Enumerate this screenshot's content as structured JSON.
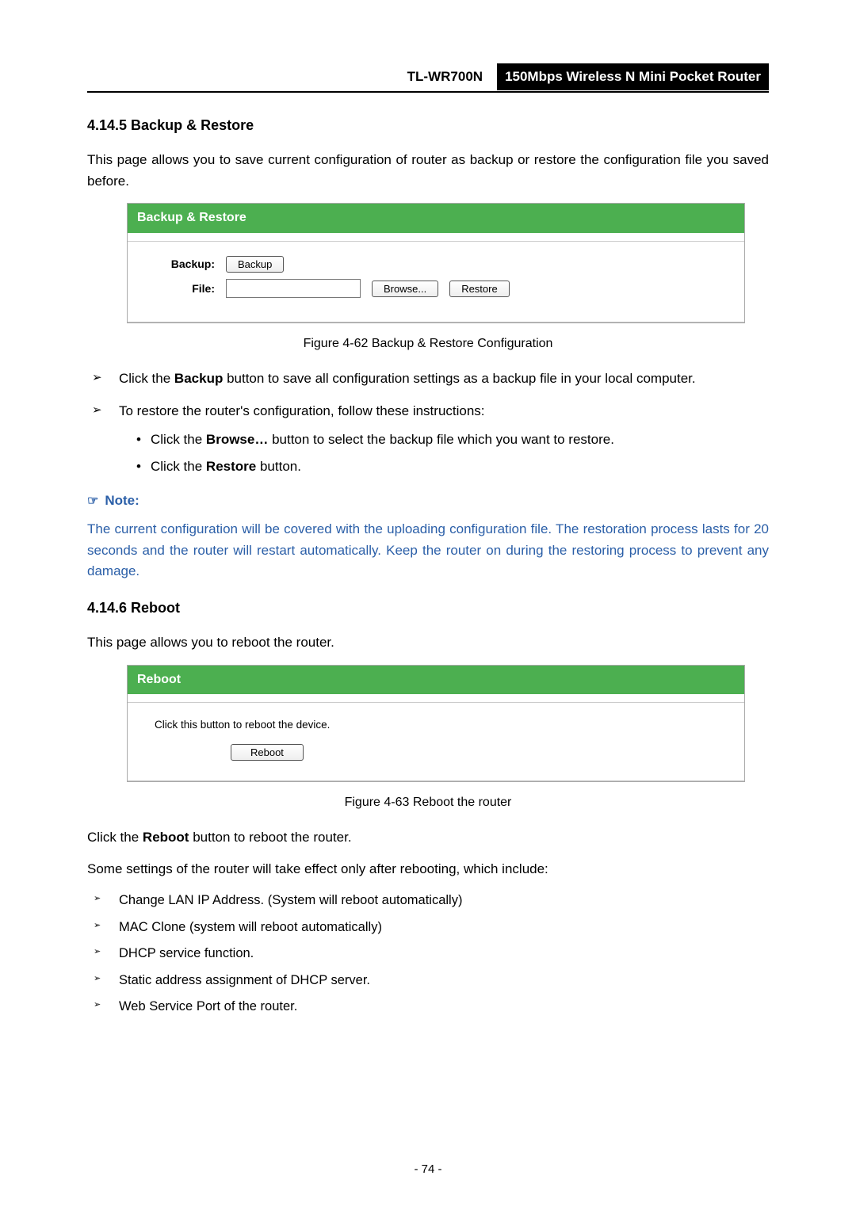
{
  "header": {
    "model": "TL-WR700N",
    "desc": "150Mbps Wireless N Mini Pocket Router"
  },
  "s1": {
    "heading": "4.14.5 Backup & Restore",
    "intro": "This page allows you to save current configuration of router as backup or restore the configuration file you saved before.",
    "panel_title": "Backup & Restore",
    "backup_label": "Backup:",
    "file_label": "File:",
    "backup_btn": "Backup",
    "browse_btn": "Browse...",
    "restore_btn": "Restore",
    "fig": "Figure 4-62 Backup & Restore Configuration",
    "li1a": "Click the ",
    "li1b": "Backup",
    "li1c": " button to save all configuration settings as a backup file in your local computer.",
    "li2": "To restore the router's configuration, follow these instructions:",
    "li2_1a": "Click the ",
    "li2_1b": "Browse…",
    "li2_1c": " button to select the backup file which you want to restore.",
    "li2_2a": "Click the ",
    "li2_2b": "Restore",
    "li2_2c": " button."
  },
  "note": {
    "label": "Note:",
    "body": "The current configuration will be covered with the uploading configuration file. The restoration process lasts for 20 seconds and the router will restart automatically. Keep the router on during the restoring process to prevent any damage."
  },
  "s2": {
    "heading": "4.14.6 Reboot",
    "intro": "This page allows you to reboot the router.",
    "panel_title": "Reboot",
    "hint": "Click this button to reboot the device.",
    "reboot_btn": "Reboot",
    "fig": "Figure 4-63 Reboot the router",
    "p1a": "Click the ",
    "p1b": "Reboot",
    "p1c": " button to reboot the router.",
    "p2": "Some settings of the router will take effect only after rebooting, which include:",
    "li1": "Change LAN IP Address. (System will reboot automatically)",
    "li2": "MAC Clone (system will reboot automatically)",
    "li3": "DHCP service function.",
    "li4": "Static address assignment of DHCP server.",
    "li5": "Web Service Port of the router."
  },
  "page_number": "- 74 -"
}
